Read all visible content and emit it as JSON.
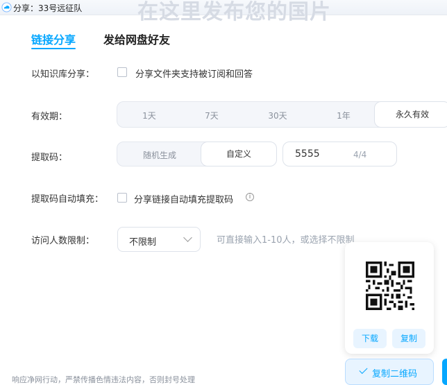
{
  "window": {
    "title": "分享：33号远征队",
    "banner_text": "在这里发布您的国片",
    "icon": "cloud-drive-icon"
  },
  "tabs": [
    {
      "label": "链接分享",
      "active": true
    },
    {
      "label": "发给网盘好友",
      "active": false
    }
  ],
  "knowledge_share": {
    "label": "以知识库分享：",
    "checkbox_text": "分享文件夹支持被订阅和回答",
    "checked": false
  },
  "validity": {
    "label": "有效期：",
    "options": [
      "1天",
      "7天",
      "30天",
      "1年",
      "永久有效"
    ],
    "selected": "永久有效"
  },
  "extract_code": {
    "label": "提取码：",
    "modes": [
      "随机生成",
      "自定义"
    ],
    "selected": "自定义",
    "value": "5555",
    "counter": "4/4"
  },
  "autofill": {
    "label": "提取码自动填充：",
    "checkbox_text": "分享链接自动填充提取码",
    "checked": false,
    "info_icon": "info-icon"
  },
  "visitor_limit": {
    "label": "访问人数限制：",
    "value": "不限制",
    "hint": "可直接输入1-10人，或选择不限制"
  },
  "qr_panel": {
    "download_label": "下载",
    "copy_label": "复制"
  },
  "copy_qr_button": {
    "label": "复制二维码"
  },
  "footer": {
    "note": "响应净网行动，严禁传播色情违法内容，否则封号处理"
  },
  "colors": {
    "accent": "#06a7ff",
    "accent_light": "#e8f4ff"
  }
}
